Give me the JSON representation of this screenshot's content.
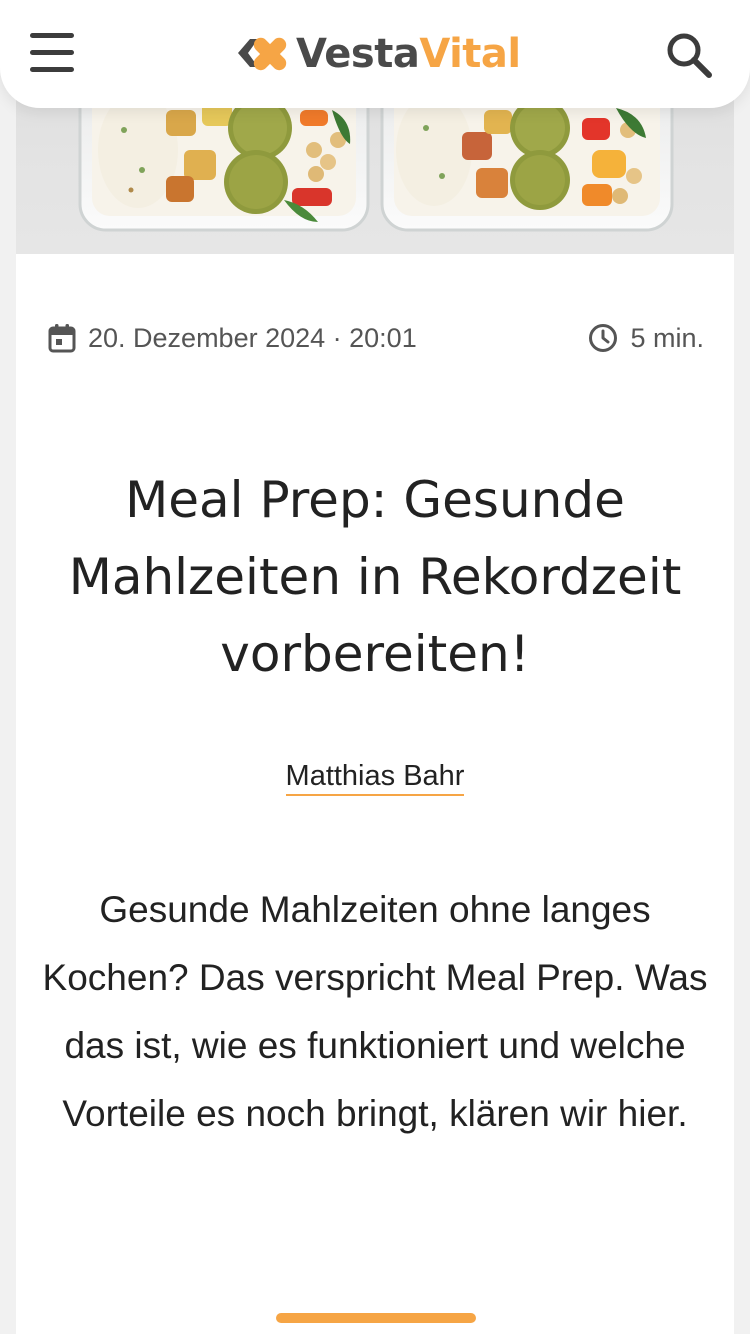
{
  "header": {
    "menu_icon": "hamburger-menu-icon",
    "logo": {
      "part1": "Vesta",
      "part2": "Vital",
      "icon": "vestavital-logo-mark",
      "color_primary": "#4a4a4a",
      "color_accent": "#f6a545"
    },
    "search_icon": "search-icon"
  },
  "hero": {
    "image": "meal-prep-containers-photo"
  },
  "article": {
    "date_icon": "calendar-icon",
    "date": "20. Dezember 2024 · 20:01",
    "reading_time_icon": "clock-icon",
    "reading_time": "5 min.",
    "title": "Meal Prep: Gesunde Mahlzeiten in Rekordzeit vorbereiten!",
    "author": "Matthias Bahr",
    "intro": "Gesunde Mahlzeiten ohne langes Kochen? Das verspricht Meal Prep. Was das ist, wie es funktioniert und welche Vorteile es noch bringt, klären wir hier."
  },
  "colors": {
    "accent": "#f6a545",
    "text": "#222222",
    "meta_text": "#555555"
  }
}
